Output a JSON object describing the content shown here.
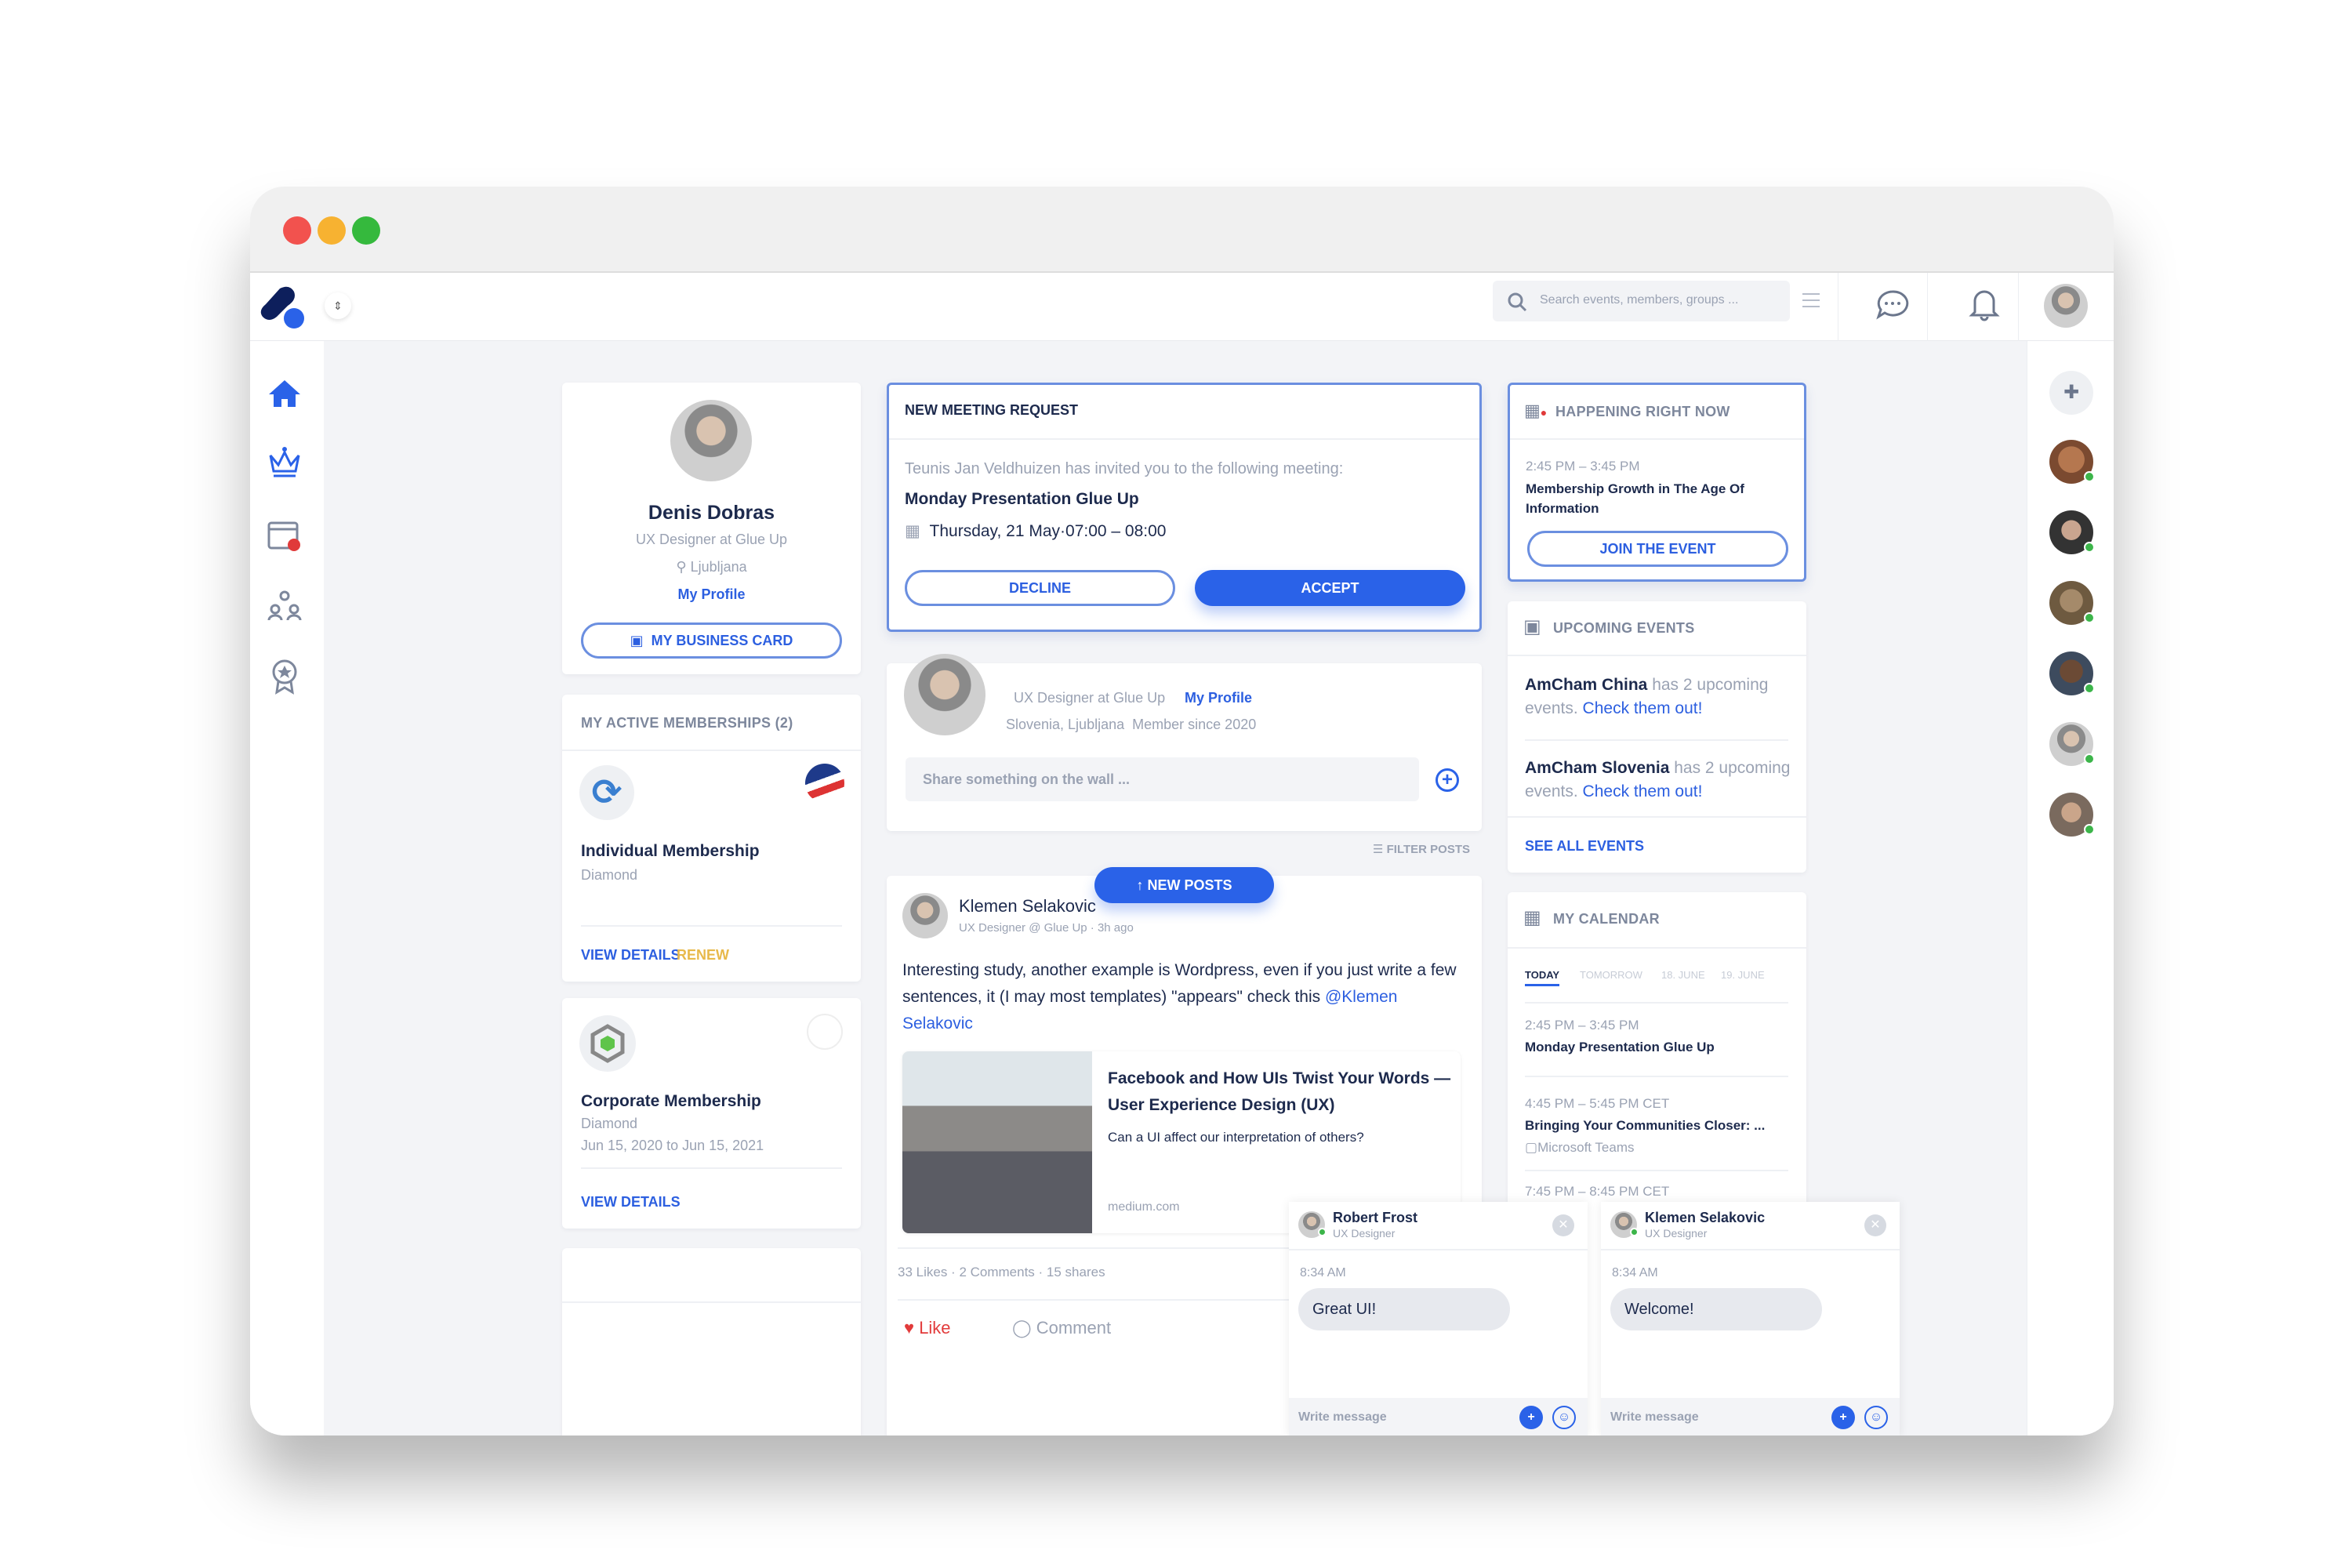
{
  "colors": {
    "accent": "#2a62e8",
    "renew": "#e8b94a",
    "online": "#3cb54a",
    "like": "#e23b3b"
  },
  "header": {
    "search_placeholder": "Search events, members, groups ..."
  },
  "sidebar": {
    "items": [
      {
        "icon": "home-icon"
      },
      {
        "icon": "crown-icon"
      },
      {
        "icon": "calendar-icon"
      },
      {
        "icon": "groups-icon"
      },
      {
        "icon": "badge-icon"
      }
    ]
  },
  "profile": {
    "name": "Denis Dobras",
    "title": "UX Designer at Glue Up",
    "location": "Ljubljana",
    "my_profile": "My Profile",
    "business_card": "MY BUSINESS CARD"
  },
  "memberships": {
    "title": "MY ACTIVE MEMBERSHIPS (2)",
    "items": [
      {
        "name": "Individual Membership",
        "tier": "Diamond",
        "dates": "",
        "view": "VIEW DETAILS",
        "renew": "RENEW"
      },
      {
        "name": "Corporate Membership",
        "tier": "Diamond",
        "dates": "Jun 15, 2020 to Jun 15, 2021",
        "view": "VIEW DETAILS"
      }
    ]
  },
  "meeting": {
    "title": "NEW MEETING REQUEST",
    "invite": "Teunis Jan Veldhuizen has invited you to the following meeting:",
    "name": "Monday Presentation Glue Up",
    "when": "Thursday, 21 May·07:00 – 08:00",
    "decline": "DECLINE",
    "accept": "ACCEPT"
  },
  "share": {
    "title": "UX Designer at Glue Up",
    "my_profile": "My Profile",
    "location": "Slovenia, Ljubljana",
    "member_since": "Member since 2020",
    "placeholder": "Share something on the wall ..."
  },
  "feed": {
    "filter": "FILTER POSTS",
    "new_posts": "↑ NEW POSTS"
  },
  "post": {
    "author": "Klemen Selakovic",
    "meta": "UX Designer @ Glue Up · 3h ago",
    "text": "Interesting study, another example is Wordpress, even if you just write a few sentences, it (I may most templates) \"appears\" check this ",
    "mention": "@Klemen Selakovic",
    "link_title": "Facebook and How UIs Twist Your Words — User Experience Design (UX)",
    "link_desc": "Can a UI affect our interpretation of others?",
    "link_domain": "medium.com",
    "likes": "33 Likes",
    "comments": "2 Comments",
    "shares": "15 shares",
    "like_label": "Like",
    "comment_label": "Comment"
  },
  "happening": {
    "title": "HAPPENING RIGHT NOW",
    "time": "2:45 PM – 3:45 PM",
    "name": "Membership Growth in The Age Of Information",
    "join": "JOIN THE EVENT"
  },
  "upcoming": {
    "title": "UPCOMING EVENTS",
    "items": [
      {
        "org": "AmCham China",
        "text": " has 2 upcoming events. ",
        "link": "Check them out!"
      },
      {
        "org": "AmCham Slovenia",
        "text": " has 2 upcoming events. ",
        "link": "Check them out!"
      }
    ],
    "see_all": "SEE ALL EVENTS"
  },
  "calendar": {
    "title": "MY CALENDAR",
    "tabs": [
      "TODAY",
      "TOMORROW",
      "18. JUNE",
      "19. JUNE"
    ],
    "events": [
      {
        "time": "2:45 PM – 3:45 PM",
        "name": "Monday Presentation Glue Up",
        "where": ""
      },
      {
        "time": "4:45 PM – 5:45 PM CET",
        "name": "Bringing Your Communities Closer: ...",
        "where": "Microsoft Teams"
      },
      {
        "time": "7:45 PM – 8:45 PM CET"
      }
    ]
  },
  "chats": [
    {
      "name": "Robert Frost",
      "role": "UX Designer",
      "time": "8:34 AM",
      "message": "Great UI!",
      "placeholder": "Write message"
    },
    {
      "name": "Klemen Selakovic",
      "role": "UX Designer",
      "time": "8:34 AM",
      "message": "Welcome!",
      "placeholder": "Write message"
    }
  ]
}
